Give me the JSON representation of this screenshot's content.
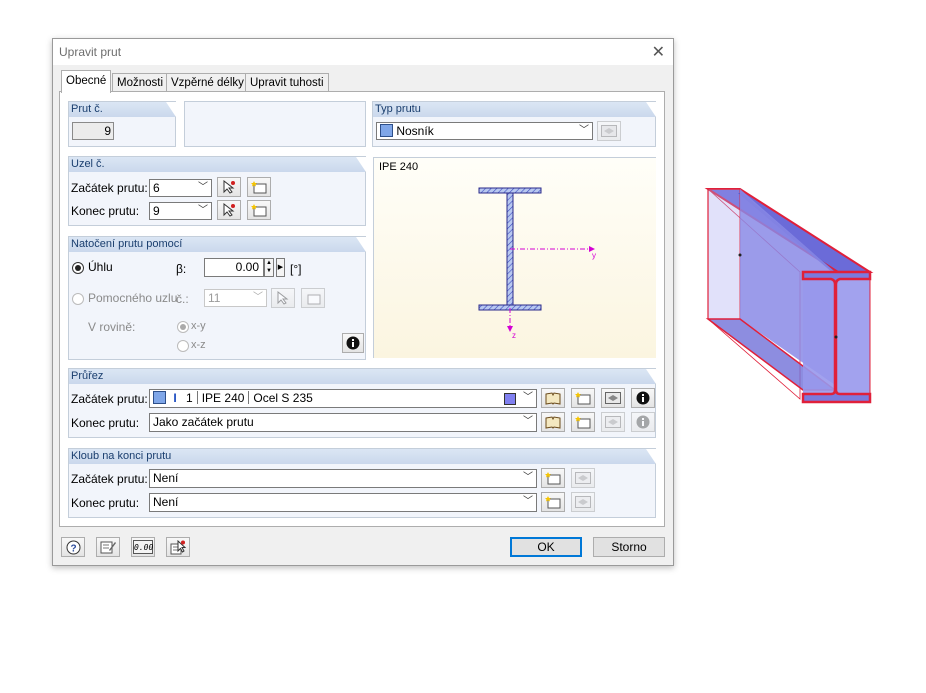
{
  "window": {
    "title": "Upravit prut"
  },
  "tabs": [
    "Obecné",
    "Možnosti",
    "Vzpěrné délky",
    "Upravit tuhosti"
  ],
  "member_no": {
    "header": "Prut č.",
    "value": "9"
  },
  "member_type": {
    "header": "Typ prutu",
    "value": "Nosník"
  },
  "nodes": {
    "header": "Uzel č.",
    "start_label": "Začátek prutu:",
    "start_value": "6",
    "end_label": "Konec prutu:",
    "end_value": "9"
  },
  "rotation": {
    "header": "Natočení prutu pomocí",
    "angle_option": "Úhlu",
    "beta_label": "β:",
    "beta_value": "0.00",
    "unit": "[°]",
    "helper_option": "Pomocného uzlu",
    "node_label": "č.:",
    "node_value": "11",
    "plane_label": "V rovině:",
    "plane_xy": "x-y",
    "plane_xz": "x-z"
  },
  "preview": {
    "section_name": "IPE 240",
    "axis_y": "y",
    "axis_z": "z"
  },
  "section": {
    "header": "Průřez",
    "start_label": "Začátek prutu:",
    "start_no": "1",
    "start_name": "IPE 240",
    "start_material": "Ocel S 235",
    "end_label": "Konec prutu:",
    "end_value": "Jako začátek prutu"
  },
  "hinge": {
    "header": "Kloub na konci prutu",
    "start_label": "Začátek prutu:",
    "start_value": "Není",
    "end_label": "Konec prutu:",
    "end_value": "Není"
  },
  "footer": {
    "ok": "OK",
    "cancel": "Storno",
    "units_icon_text": "0.00"
  },
  "colors": {
    "accent": "#0078d7",
    "group_header": "#cad8ec",
    "beam_fill": "#8a8ae6",
    "beam_edge": "#e0203a"
  }
}
